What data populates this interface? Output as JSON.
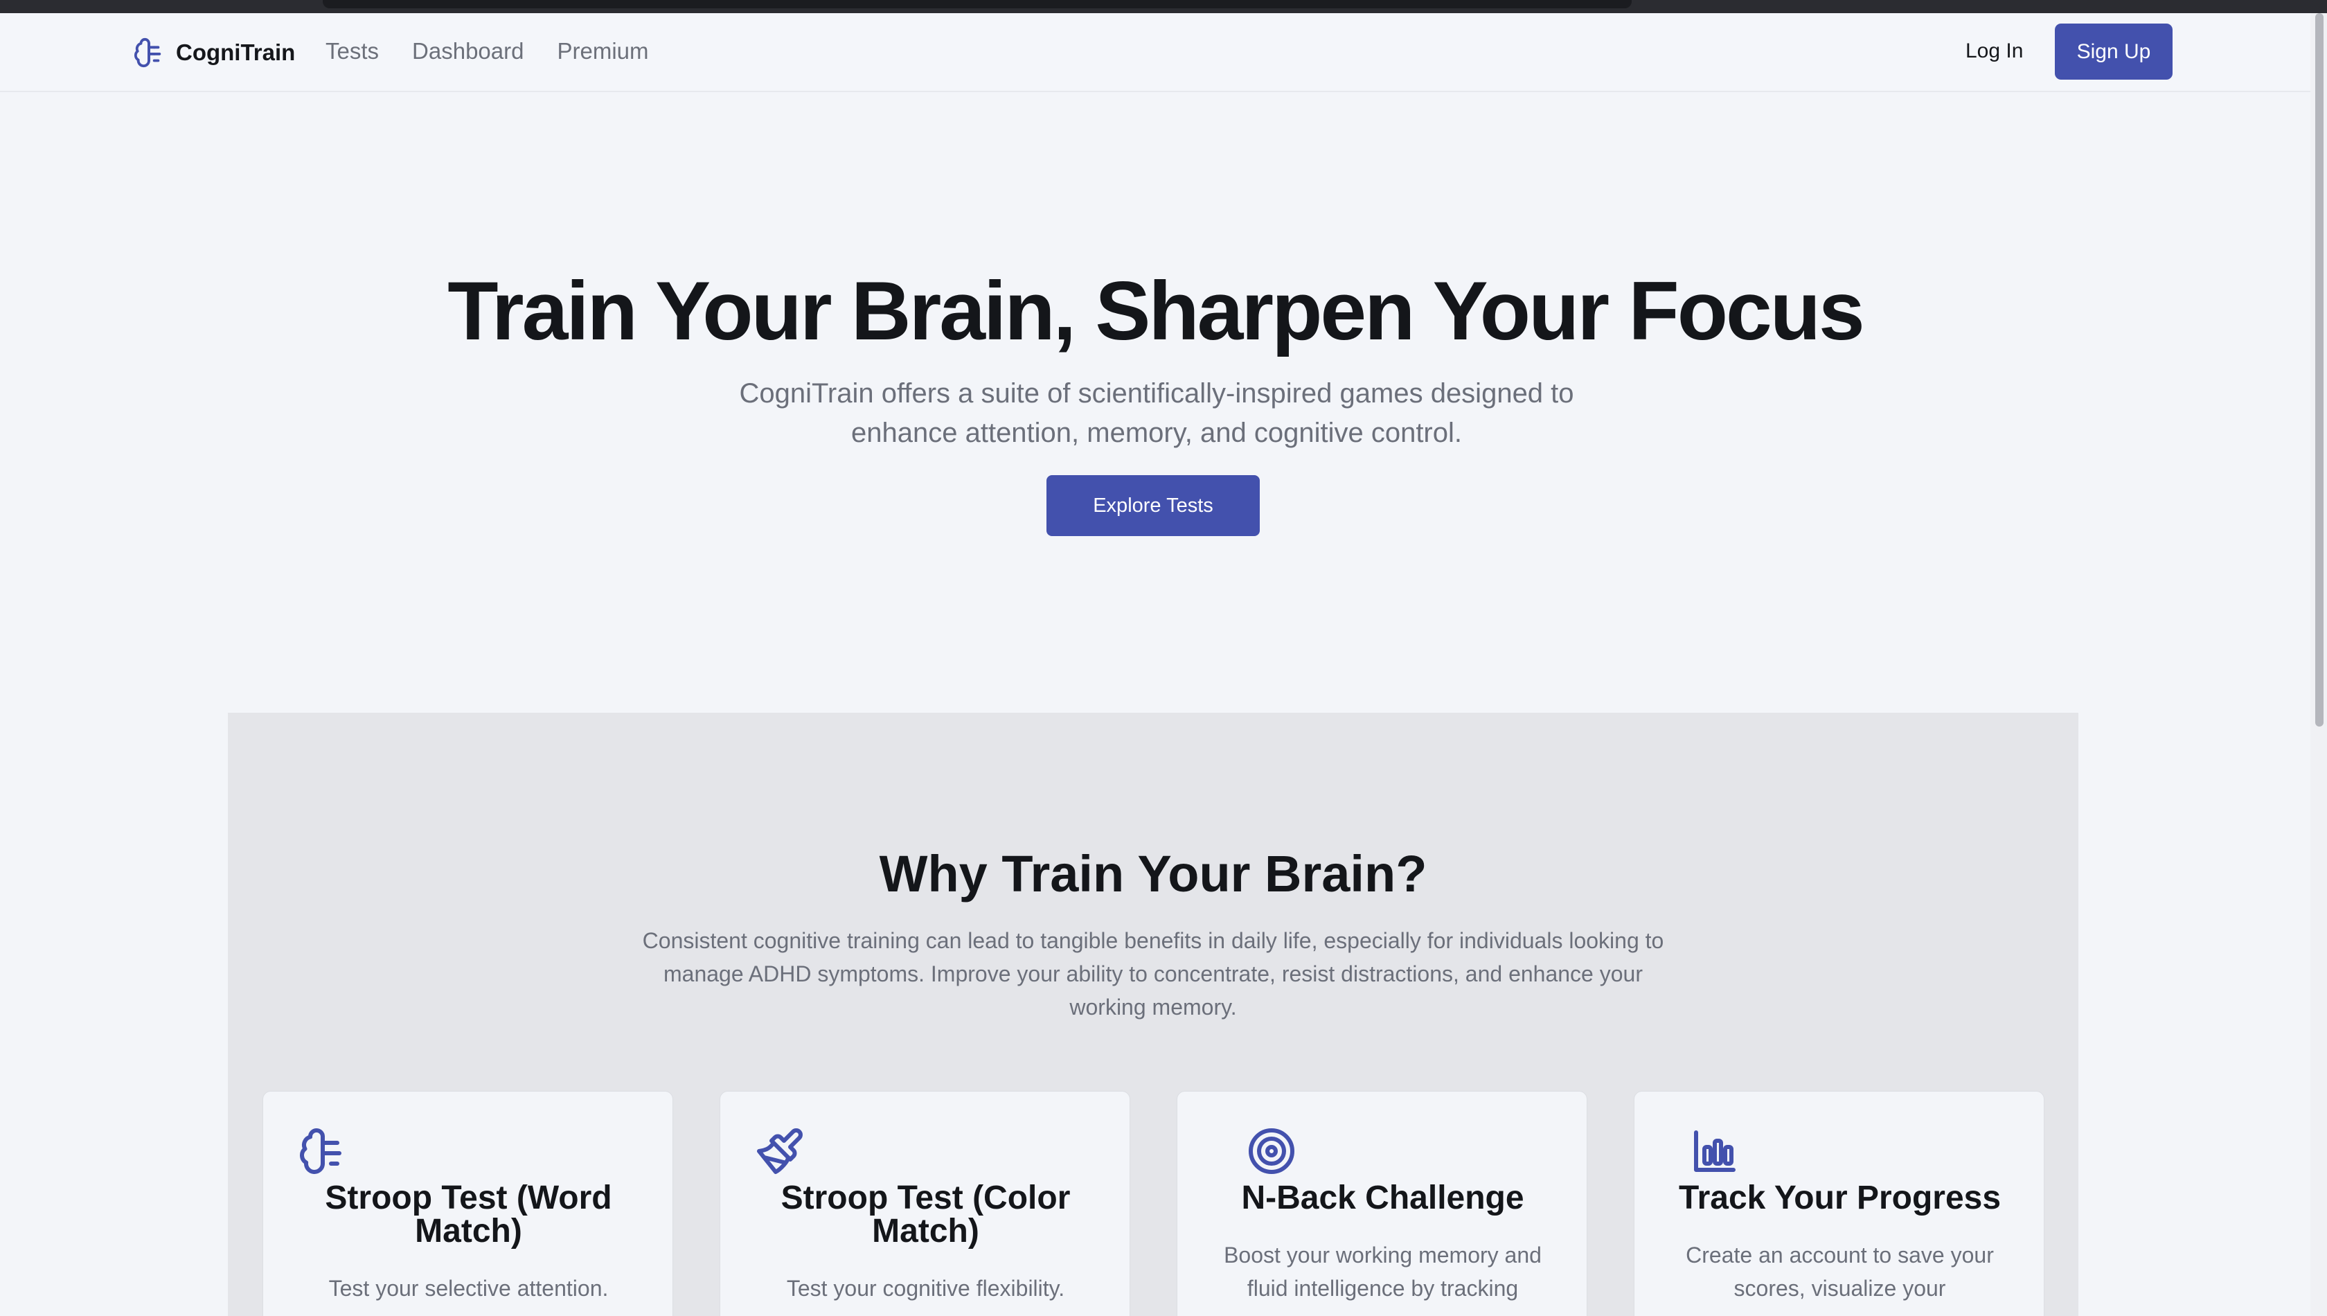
{
  "nav": {
    "brand": "CogniTrain",
    "links": [
      "Tests",
      "Dashboard",
      "Premium"
    ],
    "login": "Log In",
    "signup": "Sign Up"
  },
  "hero": {
    "title": "Train Your Brain, Sharpen Your Focus",
    "subtitle": "CogniTrain offers a suite of scientifically-inspired games designed to enhance attention, memory, and cognitive control.",
    "cta": "Explore Tests"
  },
  "why": {
    "title": "Why Train Your Brain?",
    "description": "Consistent cognitive training can lead to tangible benefits in daily life, especially for individuals looking to manage ADHD symptoms. Improve your ability to concentrate, resist distractions, and enhance your working memory.",
    "cards": [
      {
        "icon": "brain-icon",
        "title": "Stroop Test (Word Match)",
        "desc": "Test your selective attention."
      },
      {
        "icon": "paintbrush-icon",
        "title": "Stroop Test (Color Match)",
        "desc": "Test your cognitive flexibility."
      },
      {
        "icon": "target-icon",
        "title": "N-Back Challenge",
        "desc": "Boost your working memory and fluid intelligence by tracking"
      },
      {
        "icon": "bar-chart-icon",
        "title": "Track Your Progress",
        "desc": "Create an account to save your scores, visualize your"
      }
    ]
  },
  "colors": {
    "accent": "#4351ad",
    "background": "#f3f5f9",
    "section": "#e4e5e9"
  }
}
